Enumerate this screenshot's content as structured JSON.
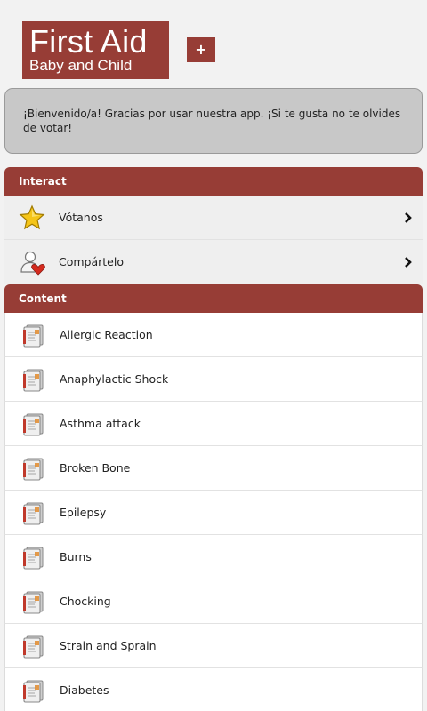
{
  "header": {
    "title": "First Aid",
    "subtitle": "Baby and Child",
    "add_label": "+",
    "brand_color": "#973d36"
  },
  "notice": {
    "text": "¡Bienvenido/a! Gracias por usar nuestra app. ¡Si te gusta no te olvides de votar!"
  },
  "interact": {
    "heading": "Interact",
    "items": [
      {
        "label": "Vótanos",
        "icon": "star-icon"
      },
      {
        "label": "Compártelo",
        "icon": "share-user-heart-icon"
      }
    ]
  },
  "content": {
    "heading": "Content",
    "items": [
      {
        "label": "Allergic Reaction",
        "icon": "first-aid-book-icon"
      },
      {
        "label": "Anaphylactic Shock",
        "icon": "first-aid-book-icon"
      },
      {
        "label": "Asthma attack",
        "icon": "first-aid-book-icon"
      },
      {
        "label": "Broken Bone",
        "icon": "first-aid-book-icon"
      },
      {
        "label": "Epilepsy",
        "icon": "first-aid-book-icon"
      },
      {
        "label": "Burns",
        "icon": "first-aid-book-icon"
      },
      {
        "label": "Chocking",
        "icon": "first-aid-book-icon"
      },
      {
        "label": "Strain and Sprain",
        "icon": "first-aid-book-icon"
      },
      {
        "label": "Diabetes",
        "icon": "first-aid-book-icon"
      }
    ]
  }
}
